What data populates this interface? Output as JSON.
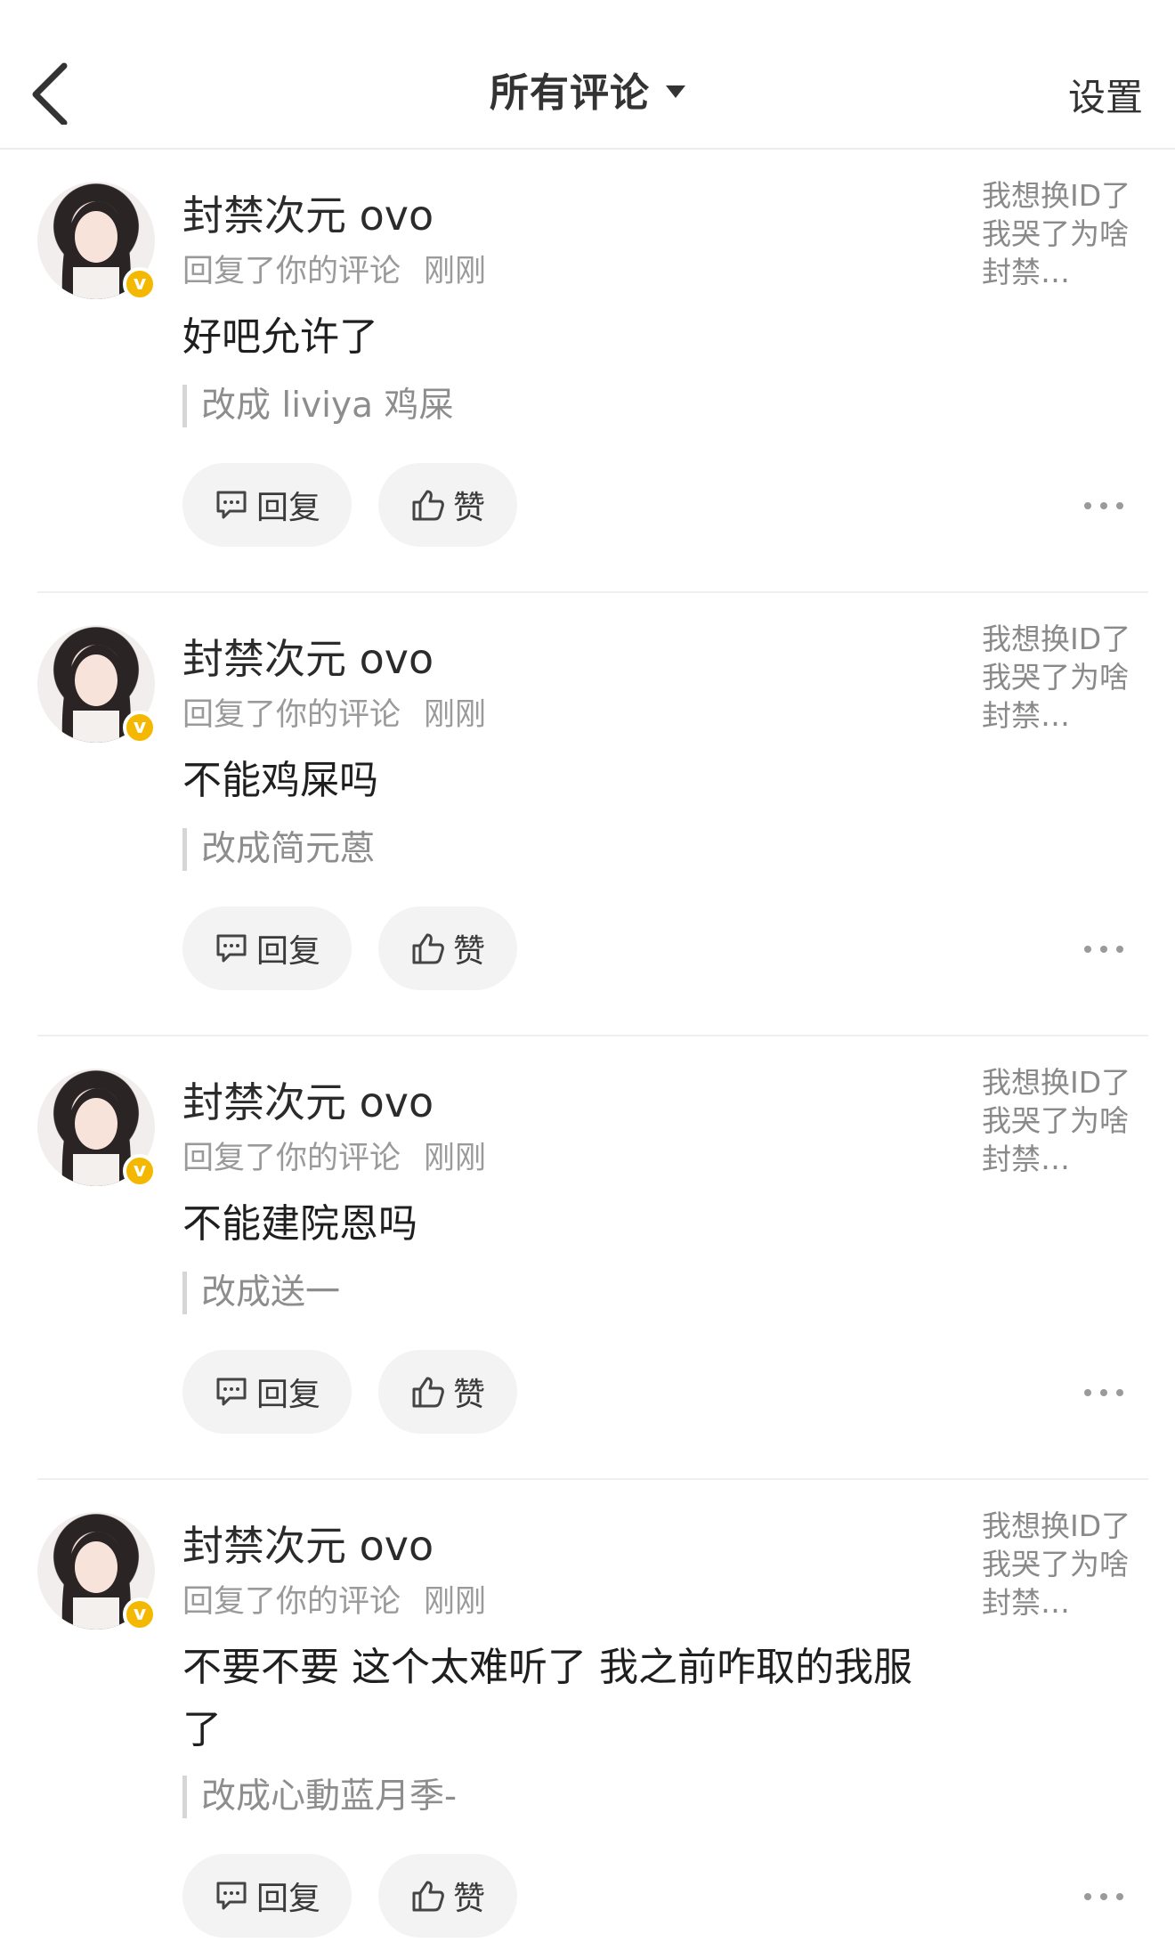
{
  "header": {
    "title": "所有评论",
    "settings_label": "设置"
  },
  "comments": [
    {
      "username": "封禁次元 ovo",
      "action": "回复了你的评论",
      "time": "刚刚",
      "reply": "好吧允许了",
      "quote": "改成 liviya 鸡屎",
      "preview": "我想换ID了我哭了为啥封禁…",
      "reply_label": "回复",
      "like_label": "赞"
    },
    {
      "username": "封禁次元 ovo",
      "action": "回复了你的评论",
      "time": "刚刚",
      "reply": "不能鸡屎吗",
      "quote": "改成简元蒽",
      "preview": "我想换ID了我哭了为啥封禁…",
      "reply_label": "回复",
      "like_label": "赞"
    },
    {
      "username": "封禁次元 ovo",
      "action": "回复了你的评论",
      "time": "刚刚",
      "reply": "不能建院恩吗",
      "quote": "改成送一",
      "preview": "我想换ID了我哭了为啥封禁…",
      "reply_label": "回复",
      "like_label": "赞"
    },
    {
      "username": "封禁次元 ovo",
      "action": "回复了你的评论",
      "time": "刚刚",
      "reply": "不要不要 这个太难听了 我之前咋取的我服了",
      "quote": "改成心動蓝月季-",
      "preview": "我想换ID了我哭了为啥封禁…",
      "reply_label": "回复",
      "like_label": "赞"
    }
  ],
  "colors": {
    "badge": "#f5b800",
    "button_bg": "#f3f3f3",
    "muted_text": "#9a9a9a"
  },
  "icons": [
    "back-arrow-icon",
    "dropdown-caret-icon",
    "verified-badge-icon",
    "comment-icon",
    "thumbs-up-icon",
    "more-icon"
  ]
}
